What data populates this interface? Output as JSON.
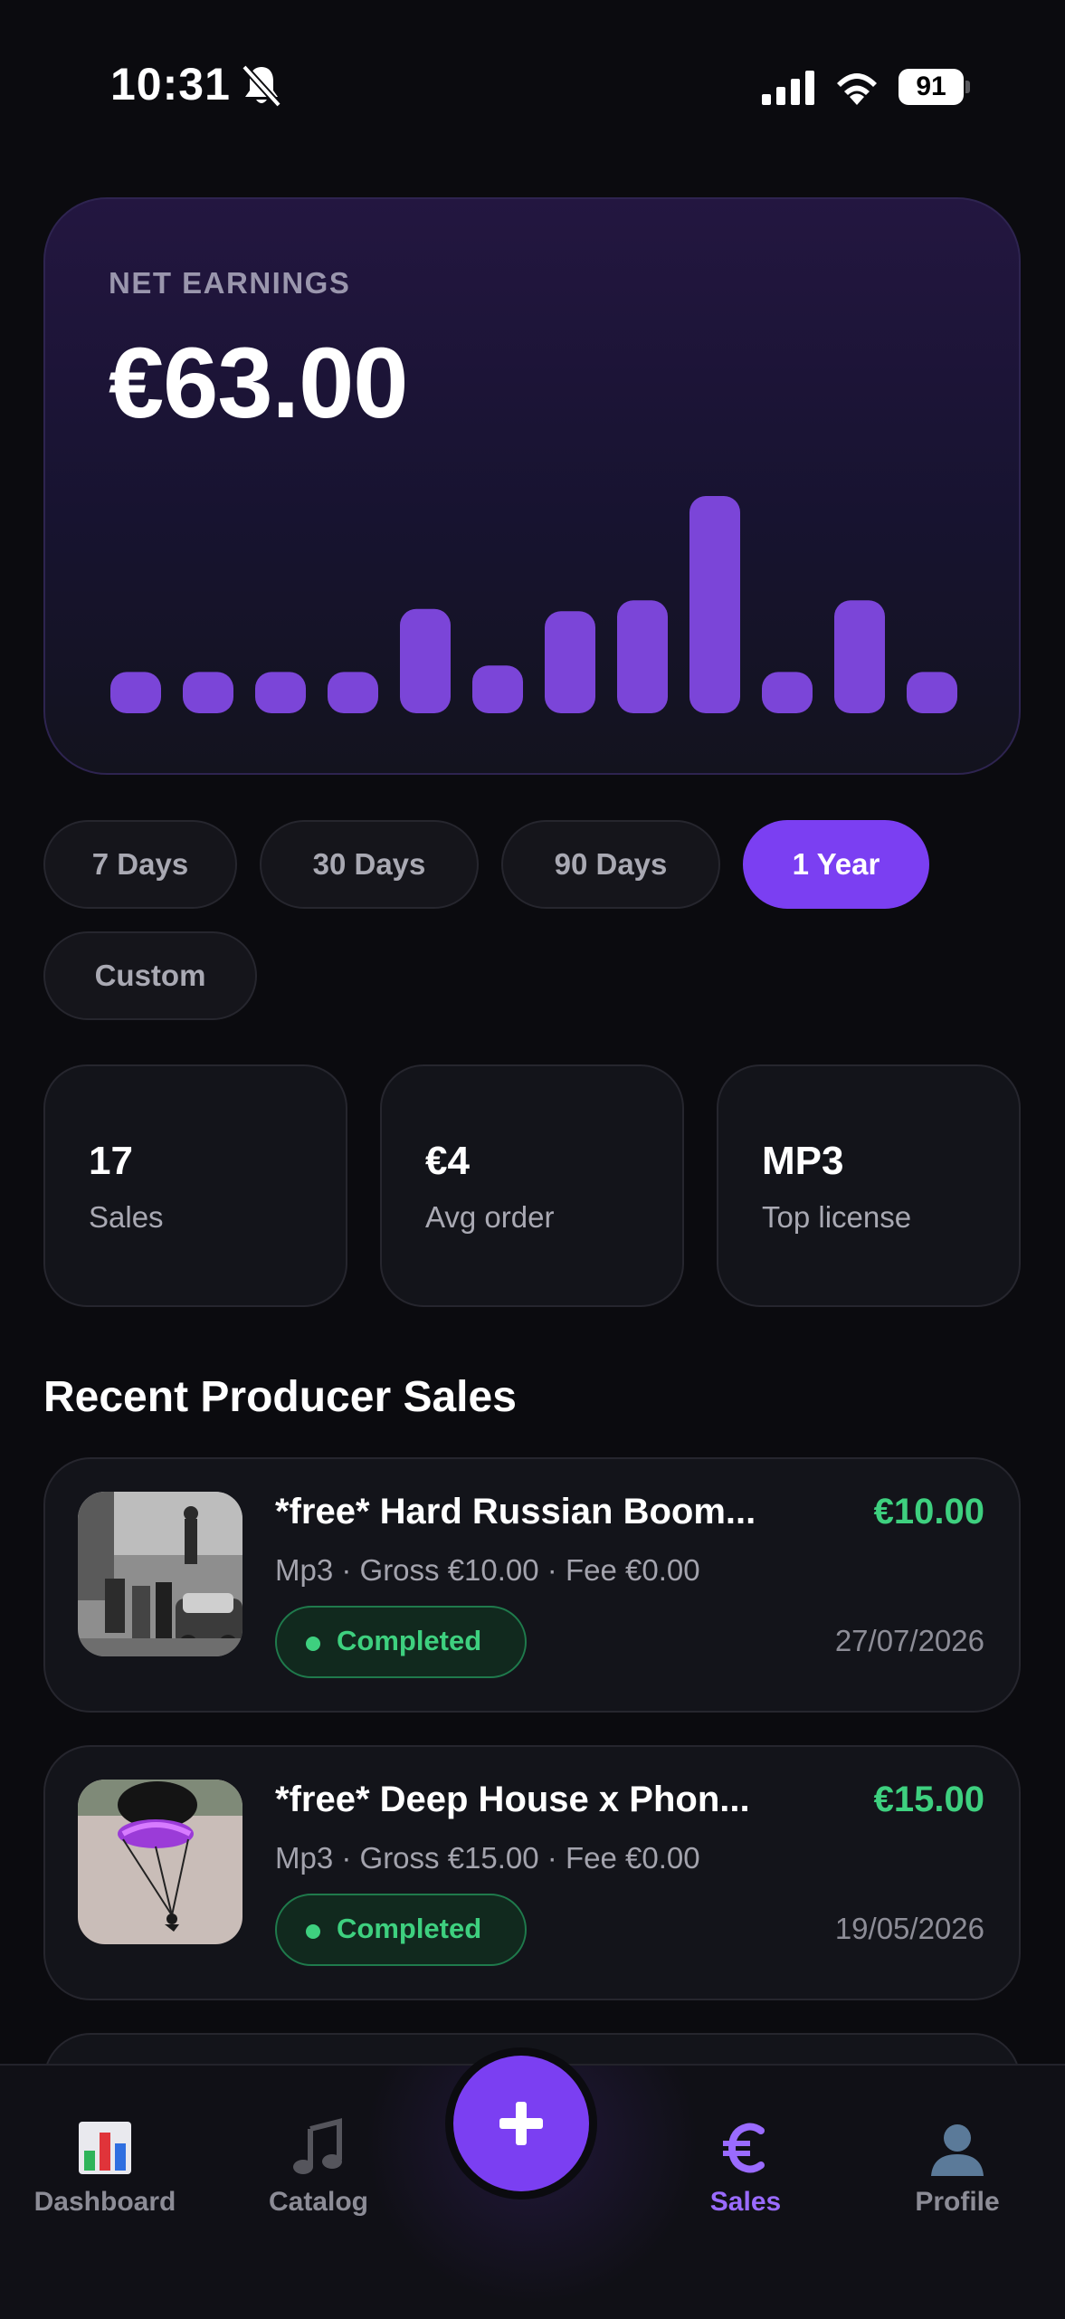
{
  "status_bar": {
    "time": "10:31",
    "battery": "91"
  },
  "earnings": {
    "label": "NET EARNINGS",
    "amount": "€63.00",
    "bar_levels": [
      0.19,
      0.19,
      0.19,
      0.19,
      0.48,
      0.22,
      0.47,
      0.52,
      1.0,
      0.19,
      0.52,
      0.19
    ],
    "bar_color": "#7b45d8"
  },
  "ranges": [
    {
      "label": "7 Days",
      "active": false
    },
    {
      "label": "30 Days",
      "active": false
    },
    {
      "label": "90 Days",
      "active": false
    },
    {
      "label": "1 Year",
      "active": true
    },
    {
      "label": "Custom",
      "active": false
    }
  ],
  "stats": [
    {
      "value": "17",
      "label": "Sales"
    },
    {
      "value": "€4",
      "label": "Avg order"
    },
    {
      "value": "MP3",
      "label": "Top license"
    }
  ],
  "recent_sales": {
    "title": "Recent Producer Sales",
    "items": [
      {
        "title": "*free* Hard Russian Boom...",
        "amount": "€10.00",
        "meta": "Mp3 · Gross €10.00 · Fee €0.00",
        "status": "Completed",
        "date": "27/07/2026",
        "thumb": "street-photo-thumbnail"
      },
      {
        "title": "*free* Deep House x Phon...",
        "amount": "€15.00",
        "meta": "Mp3 · Gross €15.00 · Fee €0.00",
        "status": "Completed",
        "date": "19/05/2026",
        "thumb": "parachute-thumbnail"
      }
    ]
  },
  "nav": {
    "items": [
      {
        "label": "Dashboard",
        "icon": "bar-chart-icon",
        "active": false
      },
      {
        "label": "Catalog",
        "icon": "music-note-icon",
        "active": false
      },
      {
        "label": "Sales",
        "icon": "euro-icon",
        "active": true
      },
      {
        "label": "Profile",
        "icon": "profile-icon",
        "active": false
      }
    ],
    "fab_icon": "plus-icon"
  },
  "colors": {
    "accent": "#7b3ff2",
    "success": "#3ed07f",
    "background": "#0b0b0f"
  }
}
